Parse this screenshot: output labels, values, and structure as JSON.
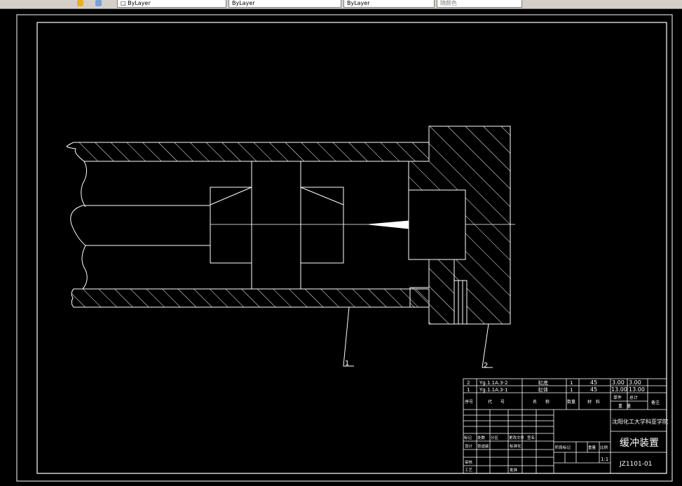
{
  "toolbar": {
    "items": [
      "□ ByLayer",
      "ByLayer",
      "ByLayer",
      "随颜色"
    ]
  },
  "drawing": {
    "callouts": [
      "1",
      "2"
    ],
    "parts_list": [
      {
        "no": "2",
        "code": "Yg.1.1A.3-2",
        "name": "缸底",
        "qty": "1",
        "material": "45",
        "unit_weight": "3.00",
        "total_weight": "3.00"
      },
      {
        "no": "1",
        "code": "Yg.1.1A.3-1",
        "name": "缸体",
        "qty": "1",
        "material": "45",
        "unit_weight": "13.00",
        "total_weight": "13.00"
      }
    ],
    "header_row": {
      "no": "序号",
      "code": "代　　号",
      "name": "名　　称",
      "qty": "数量",
      "material": "材　料",
      "unit": "单件",
      "total": "总计",
      "weight": "重　量",
      "remark": "备注"
    },
    "approval_labels": {
      "row1": [
        "标记",
        "处数",
        "分区",
        "更改文件",
        "签名"
      ],
      "row2": [
        "设计",
        "张迪兹",
        "标准化"
      ],
      "row3": [
        "审核"
      ],
      "row4": [
        "工艺",
        "批准"
      ],
      "stage": [
        "阶段标记",
        "重量",
        "比例"
      ]
    },
    "scale": "1:1",
    "school": "沈阳化工大学科亚学院",
    "title": "缓冲装置",
    "drawing_no": "JZ1101-01"
  },
  "colors": {
    "background": "#000000",
    "lines": "#ffffff",
    "toolbar": "#d4d0c8"
  }
}
